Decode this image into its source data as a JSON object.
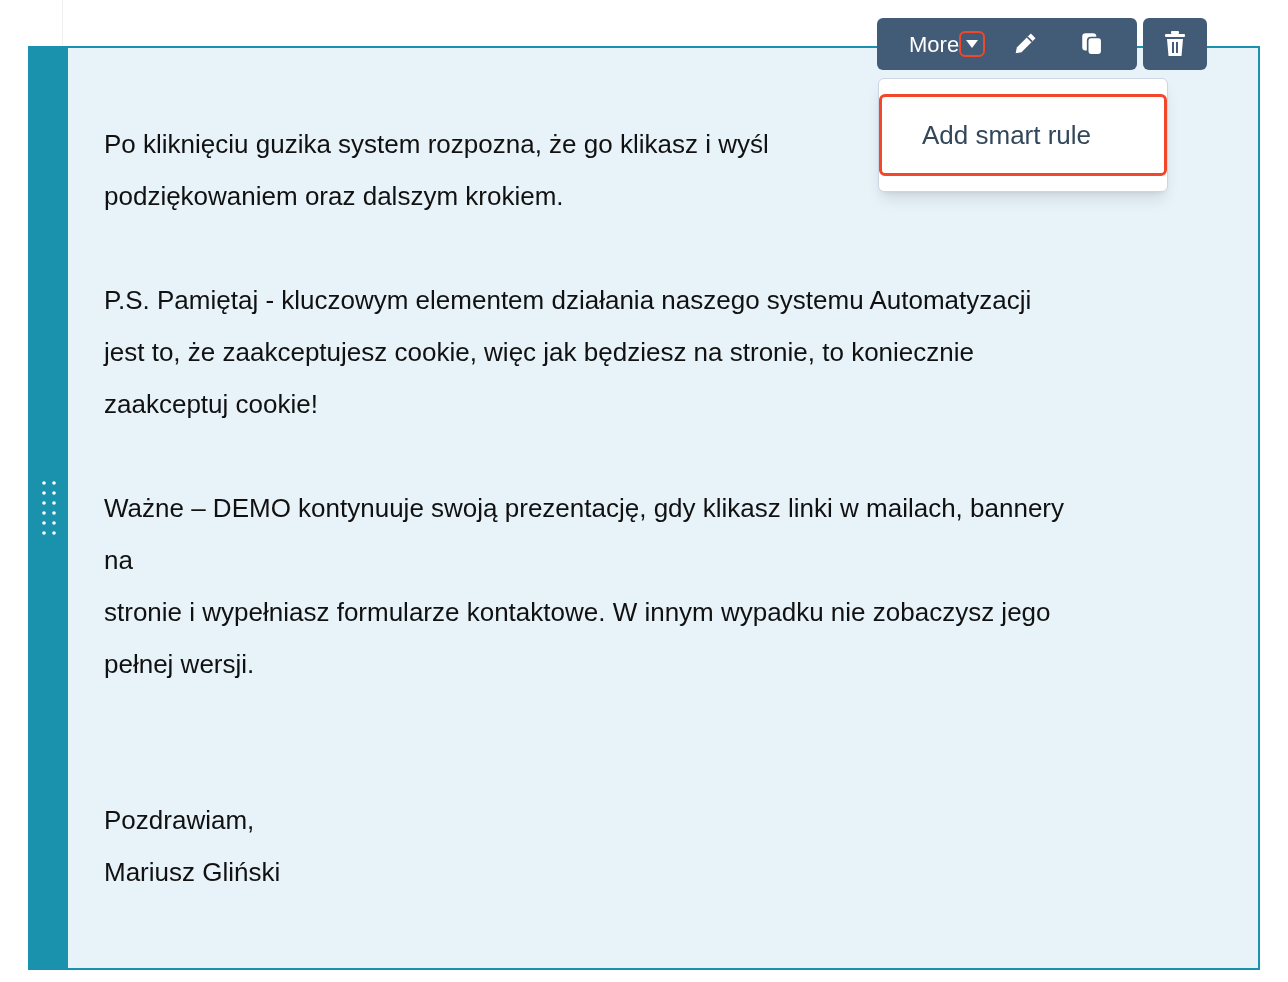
{
  "toolbar": {
    "more_label": "More",
    "menu_open": true
  },
  "menu": {
    "items": [
      {
        "label": "Add smart rule",
        "selected": true
      }
    ]
  },
  "paragraphs": [
    {
      "lines": [
        "Po kliknięciu guzika system rozpozna, że go klikasz i wyśl",
        "podziękowaniem oraz dalszym krokiem."
      ],
      "kind": "paragraph"
    },
    {
      "lines": [
        "P.S. Pamiętaj - kluczowym elementem działania naszego systemu Automatyzacji",
        "jest to, że zaakceptujesz cookie, więc jak będziesz na stronie, to koniecznie",
        "zaakceptuj cookie!"
      ],
      "kind": "paragraph"
    },
    {
      "lines": [
        "Ważne – DEMO kontynuuje swoją prezentację, gdy klikasz linki w mailach, bannery",
        "na",
        "stronie i wypełniasz formularze kontaktowe. W innym wypadku nie zobaczysz jego",
        "pełnej wersji."
      ],
      "kind": "paragraph"
    },
    {
      "lines": [
        "Pozdrawiam,",
        "Mariusz Gliński"
      ],
      "kind": "closing"
    }
  ]
}
